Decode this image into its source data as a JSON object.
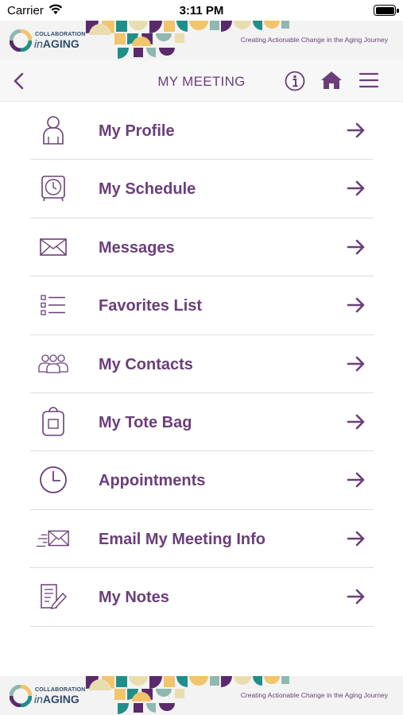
{
  "status_bar": {
    "carrier": "Carrier",
    "time": "3:11 PM"
  },
  "banner": {
    "logo_line1": "COLLABORATION",
    "logo_in": "in",
    "logo_line2": "AGING",
    "tagline": "Creating Actionable Change in the Aging Journey"
  },
  "nav": {
    "title": "MY MEETING",
    "back_icon": "chevron-left-icon",
    "info_icon": "info-icon",
    "home_icon": "home-icon",
    "menu_icon": "hamburger-icon"
  },
  "menu_items": [
    {
      "label": "My Profile",
      "icon": "person-icon"
    },
    {
      "label": "My Schedule",
      "icon": "alarm-clock-icon"
    },
    {
      "label": "Messages",
      "icon": "envelope-icon"
    },
    {
      "label": "Favorites List",
      "icon": "checklist-icon"
    },
    {
      "label": "My Contacts",
      "icon": "group-icon"
    },
    {
      "label": "My Tote Bag",
      "icon": "bag-icon"
    },
    {
      "label": "Appointments",
      "icon": "clock-icon"
    },
    {
      "label": "Email My Meeting Info",
      "icon": "email-send-icon"
    },
    {
      "label": "My Notes",
      "icon": "notes-icon"
    }
  ],
  "colors": {
    "brand_purple": "#6b3e7a",
    "logo_navy": "#2f4a6d",
    "pattern": [
      "#f2c46b",
      "#1f8f8a",
      "#5a2a6b",
      "#e9ddb0",
      "#8fb8b0"
    ]
  }
}
